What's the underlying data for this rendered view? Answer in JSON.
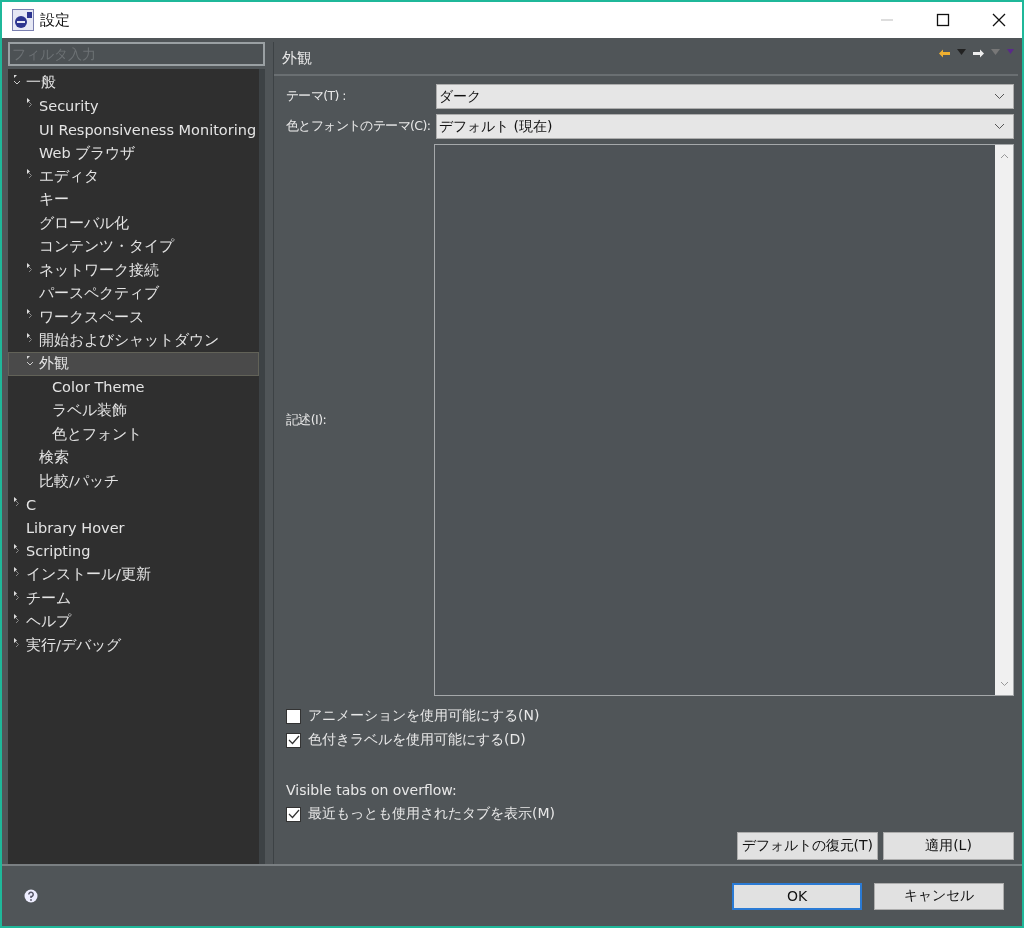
{
  "window": {
    "title": "設定"
  },
  "filter": {
    "placeholder": "フィルタ入力"
  },
  "tree": [
    {
      "label": "一般",
      "expanded": true,
      "selected": false,
      "children": [
        {
          "label": "Security",
          "expanded": false,
          "selected": false
        },
        {
          "label": "UI Responsiveness Monitoring",
          "selected": false
        },
        {
          "label": "Web ブラウザ",
          "selected": false
        },
        {
          "label": "エディタ",
          "expanded": false,
          "selected": false
        },
        {
          "label": "キー",
          "selected": false
        },
        {
          "label": "グローバル化",
          "selected": false
        },
        {
          "label": "コンテンツ・タイプ",
          "selected": false
        },
        {
          "label": "ネットワーク接続",
          "expanded": false,
          "selected": false
        },
        {
          "label": "パースペクティブ",
          "selected": false
        },
        {
          "label": "ワークスペース",
          "expanded": false,
          "selected": false
        },
        {
          "label": "開始およびシャットダウン",
          "expanded": false,
          "selected": false
        },
        {
          "label": "外観",
          "expanded": true,
          "selected": true,
          "children": [
            {
              "label": "Color Theme",
              "selected": false
            },
            {
              "label": "ラベル装飾",
              "selected": false
            },
            {
              "label": "色とフォント",
              "selected": false
            }
          ]
        },
        {
          "label": "検索",
          "selected": false
        },
        {
          "label": "比較/パッチ",
          "selected": false
        }
      ]
    },
    {
      "label": "C",
      "expanded": false,
      "selected": false
    },
    {
      "label": "Library Hover",
      "selected": false
    },
    {
      "label": "Scripting",
      "expanded": false,
      "selected": false
    },
    {
      "label": "インストール/更新",
      "expanded": false,
      "selected": false
    },
    {
      "label": "チーム",
      "expanded": false,
      "selected": false
    },
    {
      "label": "ヘルプ",
      "expanded": false,
      "selected": false
    },
    {
      "label": "実行/デバッグ",
      "expanded": false,
      "selected": false
    }
  ],
  "page": {
    "title": "外観",
    "fields": [
      {
        "label": "テーマ(T) :",
        "value": "ダーク"
      },
      {
        "label": "色とフォントのテーマ(C):",
        "value": "デフォルト (現在)"
      }
    ],
    "description_label": "記述(I):",
    "checkboxes": [
      {
        "label": "アニメーションを使用可能にする(N)",
        "checked": false
      },
      {
        "label": "色付きラベルを使用可能にする(D)",
        "checked": true
      }
    ],
    "overflow_label": "Visible tabs on overflow:",
    "overflow_checkboxes": [
      {
        "label": "最近もっとも使用されたタブを表示(M)",
        "checked": true
      }
    ],
    "buttons": [
      "デフォルトの復元(T)",
      "適用(L)"
    ]
  },
  "dialog_buttons": [
    {
      "label": "OK",
      "default": true
    },
    {
      "label": "キャンセル",
      "default": false
    }
  ]
}
